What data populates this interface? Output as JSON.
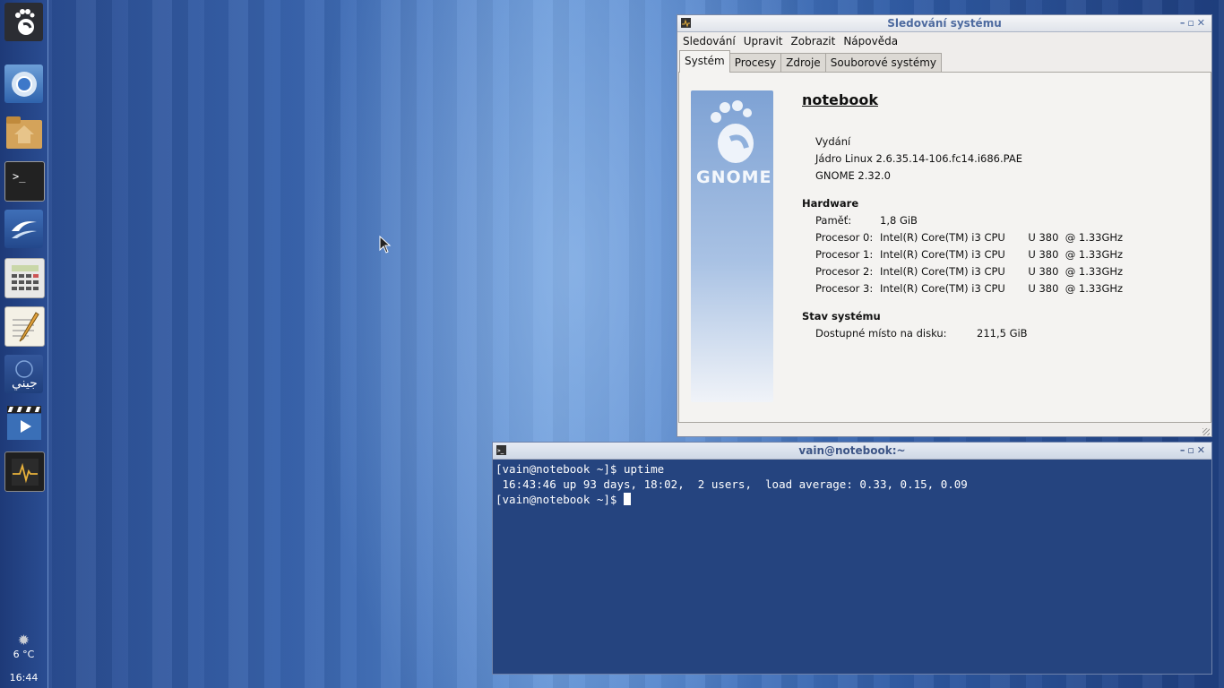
{
  "dock": {
    "items": [
      {
        "name": "gnome-foot-icon"
      },
      {
        "name": "chromium-icon"
      },
      {
        "name": "home-folder-icon"
      },
      {
        "name": "terminal-icon"
      },
      {
        "name": "writer-icon"
      },
      {
        "name": "calculator-icon"
      },
      {
        "name": "text-editor-icon"
      },
      {
        "name": "arabic-app-icon"
      },
      {
        "name": "video-player-icon"
      },
      {
        "name": "system-monitor-icon"
      }
    ],
    "weather": "6 °C",
    "clock": "16:44"
  },
  "sysmon": {
    "title": "Sledování systému",
    "menu": [
      "Sledování",
      "Upravit",
      "Zobrazit",
      "Nápověda"
    ],
    "tabs": [
      "Systém",
      "Procesy",
      "Zdroje",
      "Souborové systémy"
    ],
    "logo_text": "GNOME",
    "hostname": "notebook",
    "release_label": "Vydání",
    "kernel": "Jádro Linux 2.6.35.14-106.fc14.i686.PAE",
    "gnome_version": "GNOME 2.32.0",
    "hardware_header": "Hardware",
    "memory_label": "Paměť:",
    "memory_value": "1,8 GiB",
    "processors": [
      {
        "label": "Procesor 0:",
        "value": "Intel(R) Core(TM) i3 CPU       U 380  @ 1.33GHz"
      },
      {
        "label": "Procesor 1:",
        "value": "Intel(R) Core(TM) i3 CPU       U 380  @ 1.33GHz"
      },
      {
        "label": "Procesor 2:",
        "value": "Intel(R) Core(TM) i3 CPU       U 380  @ 1.33GHz"
      },
      {
        "label": "Procesor 3:",
        "value": "Intel(R) Core(TM) i3 CPU       U 380  @ 1.33GHz"
      }
    ],
    "status_header": "Stav systému",
    "disk_label": "Dostupné místo na disku:",
    "disk_value": "211,5 GiB"
  },
  "terminal": {
    "title": "vain@notebook:~",
    "lines": [
      "[vain@notebook ~]$ uptime",
      " 16:43:46 up 93 days, 18:02,  2 users,  load average: 0.33, 0.15, 0.09"
    ],
    "prompt": "[vain@notebook ~]$ "
  },
  "colors": {
    "titlebar_text": "#4d6a9f",
    "terminal_bg": "#25447f"
  }
}
